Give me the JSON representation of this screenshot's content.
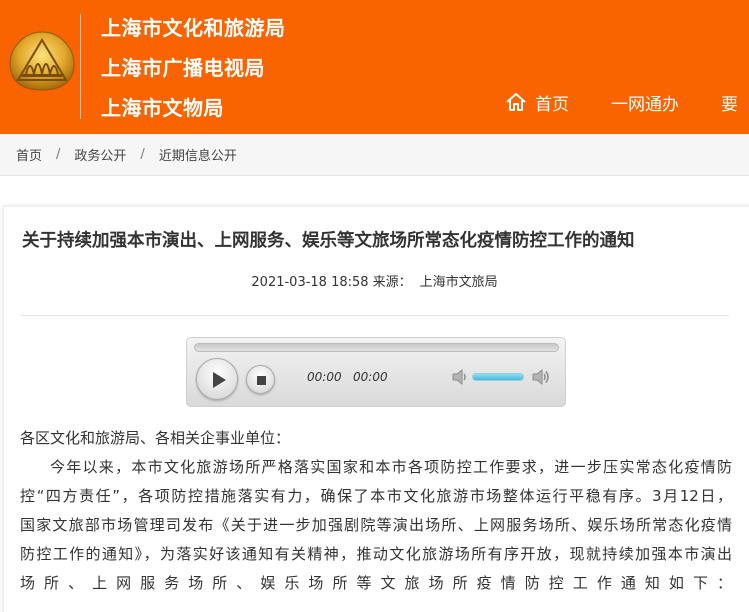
{
  "header": {
    "org_names": [
      "上海市文化和旅游局",
      "上海市广播电视局",
      "上海市文物局"
    ],
    "nav": {
      "home": "首页",
      "service": "一网通办",
      "partial": "要"
    },
    "colors": {
      "brand": "#f96401",
      "text_on_brand": "#ffffff"
    },
    "logo_icon": "shanghai-culture-emblem"
  },
  "breadcrumb": {
    "items": [
      "首页",
      "政务公开",
      "近期信息公开"
    ],
    "separator": "/"
  },
  "article": {
    "title": "关于持续加强本市演出、上网服务、娱乐等文旅场所常态化疫情防控工作的通知",
    "datetime": "2021-03-18 18:58",
    "source_label": "来源：",
    "source": "上海市文旅局",
    "audio": {
      "current_time": "00:00",
      "duration": "00:00",
      "progress": 0,
      "volume": 0.8
    },
    "salutation": "各区文化和旅游局、各相关企事业单位：",
    "paragraph_lines": [
      "今年以来，本市文化旅游场所严格落实国家和本市各项防控工作要求，进一步压实常态化疫情防",
      "控“四方责任”，各项防控措施落实有力，确保了本市文化旅游市场整体运行平稳有序。3月12日，",
      "国家文旅部市场管理司发布《关于进一步加强剧院等演出场所、上网服务场所、娱乐场所常态化疫情",
      "防控工作的通知》，为落实好该通知有关精神，推动文化旅游场所有序开放，现就持续加强本市演出",
      "场所、上网服务场所、娱乐场所等文旅场所疫情防控工作通知如下："
    ]
  }
}
